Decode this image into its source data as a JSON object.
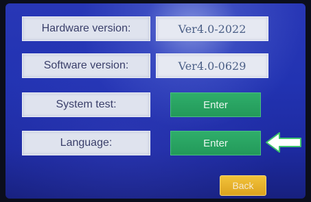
{
  "rows": {
    "hardware": {
      "label": "Hardware version:",
      "value": "Ver4.0-2022"
    },
    "software": {
      "label": "Software version:",
      "value": "Ver4.0-0629"
    },
    "system_test": {
      "label": "System test:",
      "button": "Enter"
    },
    "language": {
      "label": "Language:",
      "button": "Enter"
    }
  },
  "back_button": "Back",
  "indicator_icon": "arrow-left-icon",
  "colors": {
    "background": "#2233b2",
    "label_box": "#dfe3ee",
    "enter_button": "#2fae6a",
    "back_button": "#e8b42c",
    "arrow": "#ffffff"
  }
}
